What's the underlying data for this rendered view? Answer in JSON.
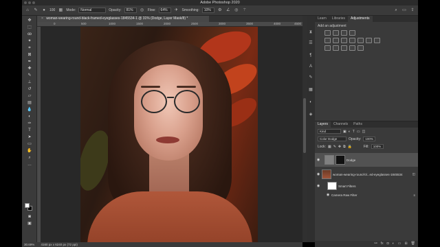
{
  "app": {
    "title": "Adobe Photoshop 2020"
  },
  "options_bar": {
    "brush_size": "100",
    "mode_label": "Mode:",
    "mode_value": "Normal",
    "opacity_label": "Opacity:",
    "opacity_value": "81%",
    "flow_label": "Flow:",
    "flow_value": "64%",
    "smoothing_label": "Smoothing:",
    "smoothing_value": "10%"
  },
  "document": {
    "tab_title": "woman-wearing-round-black-framed-eyeglasses-1845534-1 @ 31% (Dodge, Layer Mask/8) *",
    "ruler_ticks": [
      "0",
      "500",
      "1000",
      "1500",
      "2000",
      "2500",
      "3000",
      "3500",
      "4000",
      "4500"
    ]
  },
  "status": {
    "zoom": "30.69%",
    "dimensions": "4160 px x 6240 px (72 ppi)"
  },
  "panels": {
    "tabs": [
      "Learn",
      "Libraries",
      "Adjustments"
    ],
    "active_tab": "Adjustments",
    "adjustments_title": "Add an adjustment"
  },
  "layers_panel": {
    "tabs": [
      "Layers",
      "Channels",
      "Paths"
    ],
    "filter_kind": "Kind",
    "blend_mode": "Color Dodge",
    "opacity_label": "Opacity:",
    "opacity_value": "100%",
    "lock_label": "Lock:",
    "fill_label": "Fill:",
    "fill_value": "100%",
    "layers": [
      {
        "name": "Dodge",
        "selected": true
      },
      {
        "name": "woman-wearing-round-bl...ed-eyeglasses-1845534",
        "selected": false
      },
      {
        "name": "Smart Filters",
        "selected": false
      },
      {
        "name": "Camera Raw Filter",
        "selected": false
      }
    ],
    "footer_icons": [
      "link-icon",
      "fx-icon",
      "mask-icon",
      "adjustment-icon",
      "folder-icon",
      "new-layer-icon",
      "trash-icon"
    ]
  },
  "colors": {
    "ui_dark": "#3a3a3a",
    "canvas_bg": "#282828",
    "selected_layer": "#525252"
  }
}
